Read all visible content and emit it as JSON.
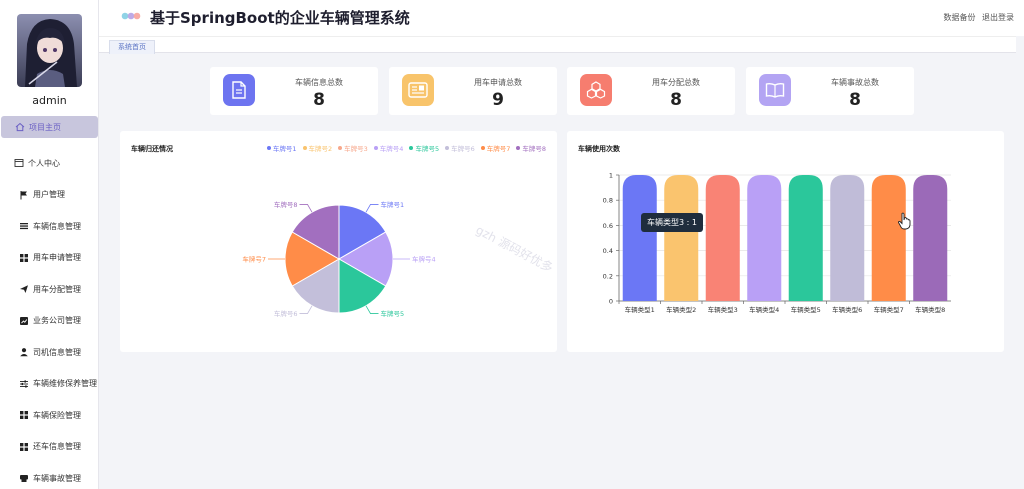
{
  "sidebar": {
    "username": "admin",
    "items": [
      {
        "label": "项目主页",
        "icon": "home-icon"
      },
      {
        "label": "个人中心",
        "icon": "window-icon"
      },
      {
        "label": "用户管理",
        "icon": "flag-icon"
      },
      {
        "label": "车辆信息管理",
        "icon": "list-icon"
      },
      {
        "label": "用车申请管理",
        "icon": "grid-icon"
      },
      {
        "label": "用车分配管理",
        "icon": "send-icon"
      },
      {
        "label": "业务公司管理",
        "icon": "chart-square-icon"
      },
      {
        "label": "司机信息管理",
        "icon": "user-icon"
      },
      {
        "label": "车辆维修保养管理",
        "icon": "sliders-icon"
      },
      {
        "label": "车辆保险管理",
        "icon": "grid-icon"
      },
      {
        "label": "还车信息管理",
        "icon": "grid-icon"
      },
      {
        "label": "车辆事故管理",
        "icon": "printer-icon"
      }
    ]
  },
  "header": {
    "title": "基于SpringBoot的企业车辆管理系统",
    "backup_label": "数据备份",
    "logout_label": "退出登录"
  },
  "tabs": [
    {
      "label": "系统首页"
    }
  ],
  "cards": [
    {
      "label": "车辆信息总数",
      "value": "8",
      "color": "#6d74f0",
      "icon": "document-icon"
    },
    {
      "label": "用车申请总数",
      "value": "9",
      "color": "#f8c46b",
      "icon": "id-card-icon"
    },
    {
      "label": "用车分配总数",
      "value": "8",
      "color": "#f67d6f",
      "icon": "cubes-icon"
    },
    {
      "label": "车辆事故总数",
      "value": "8",
      "color": "#b3a4f3",
      "icon": "book-icon"
    }
  ],
  "chart_data": [
    {
      "type": "pie",
      "title": "车辆归还情况",
      "legend_position": "top-right",
      "categories": [
        "车牌号1",
        "车牌号2",
        "车牌号3",
        "车牌号4",
        "车牌号5",
        "车牌号6",
        "车牌号7",
        "车牌号8"
      ],
      "values": [
        1,
        0,
        0,
        1,
        1,
        1,
        1,
        1
      ],
      "colors": [
        "#6b77f5",
        "#f9c36d",
        "#f7a78b",
        "#b9a0f6",
        "#2bc79b",
        "#c3bfda",
        "#ff8c48",
        "#a26fbf"
      ]
    },
    {
      "type": "bar",
      "title": "车辆使用次数",
      "categories": [
        "车辆类型1",
        "车辆类型2",
        "车辆类型3",
        "车辆类型4",
        "车辆类型5",
        "车辆类型6",
        "车辆类型7",
        "车辆类型8"
      ],
      "values": [
        1,
        1,
        1,
        1,
        1,
        1,
        1,
        1
      ],
      "ylim": [
        0,
        1
      ],
      "yticks": [
        "0",
        "0.2",
        "0.4",
        "0.6",
        "0.8",
        "1"
      ],
      "grid": true,
      "colors": [
        "#6b77f5",
        "#fac46e",
        "#f98375",
        "#b9a0f6",
        "#2bc79b",
        "#c0bcd8",
        "#ff8c48",
        "#9b6ab8"
      ],
      "tooltip": "车辆类型3 : 1"
    }
  ],
  "watermark": "gzh 源码好优多"
}
